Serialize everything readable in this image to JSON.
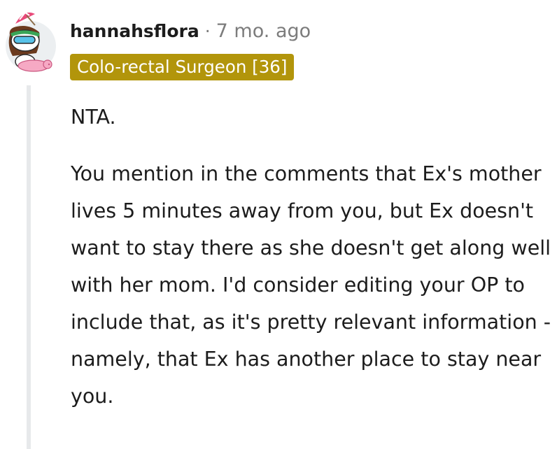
{
  "comment": {
    "author": "hannahsflora",
    "separator": "·",
    "timestamp": "7 mo. ago",
    "flair": "Colo-rectal Surgeon [36]",
    "avatar_icon": "snoo-avatar-icon",
    "paragraphs": [
      "NTA.",
      "You mention in the comments that Ex's mother lives 5 minutes away from you, but Ex doesn't want to stay there as she doesn't get along well with her mom. I'd consider editing your OP to include that, as it's pretty relevant information - namely, that Ex has another place to stay near you."
    ]
  },
  "colors": {
    "flair_background": "#b2950b",
    "text": "#1c1c1c",
    "muted": "#7c7c7c",
    "thread_line": "#e7e9eb"
  }
}
